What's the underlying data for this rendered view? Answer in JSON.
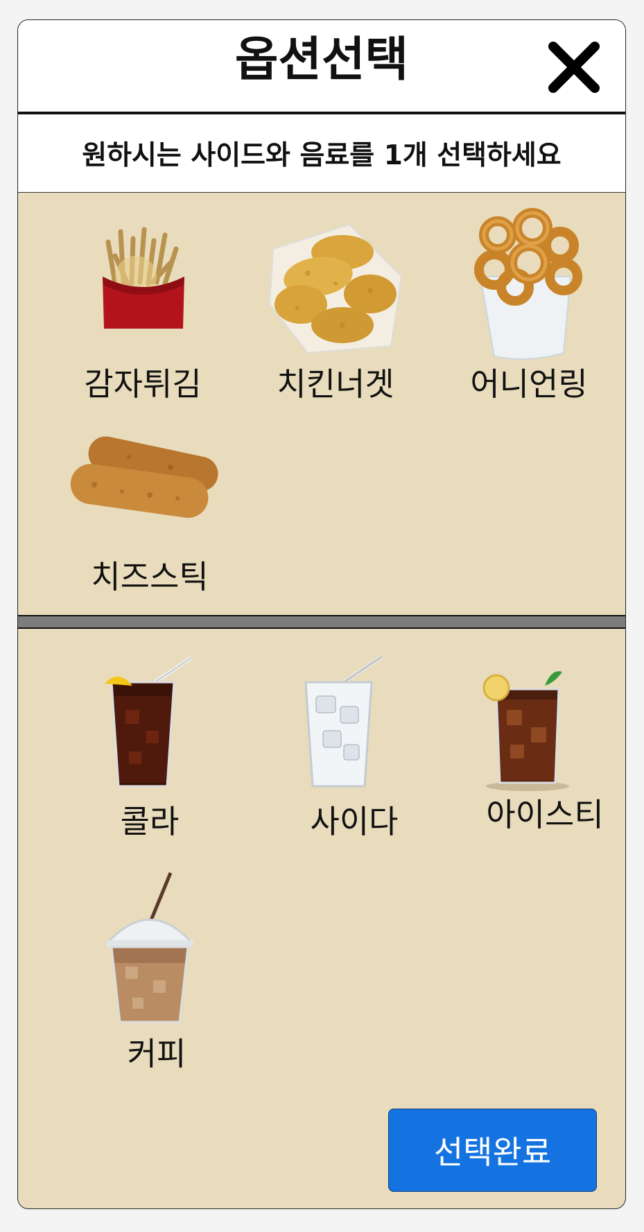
{
  "dialog": {
    "title": "옵션선택",
    "instruction": "원하시는 사이드와 음료를 1개 선택하세요",
    "confirm_label": "선택완료",
    "close_icon": "close-icon"
  },
  "sides": [
    {
      "label": "감자튀김",
      "icon": "french-fries-icon"
    },
    {
      "label": "치킨너겟",
      "icon": "chicken-nuggets-icon"
    },
    {
      "label": "어니언링",
      "icon": "onion-rings-icon"
    },
    {
      "label": "치즈스틱",
      "icon": "cheese-sticks-icon"
    }
  ],
  "drinks": [
    {
      "label": "콜라",
      "icon": "cola-icon"
    },
    {
      "label": "사이다",
      "icon": "cider-icon"
    },
    {
      "label": "아이스티",
      "icon": "iced-tea-icon"
    },
    {
      "label": "커피",
      "icon": "iced-coffee-icon"
    }
  ],
  "colors": {
    "panel_background": "#e8dcbc",
    "confirm_button": "#1473e0",
    "divider": "#7c7c7c"
  }
}
